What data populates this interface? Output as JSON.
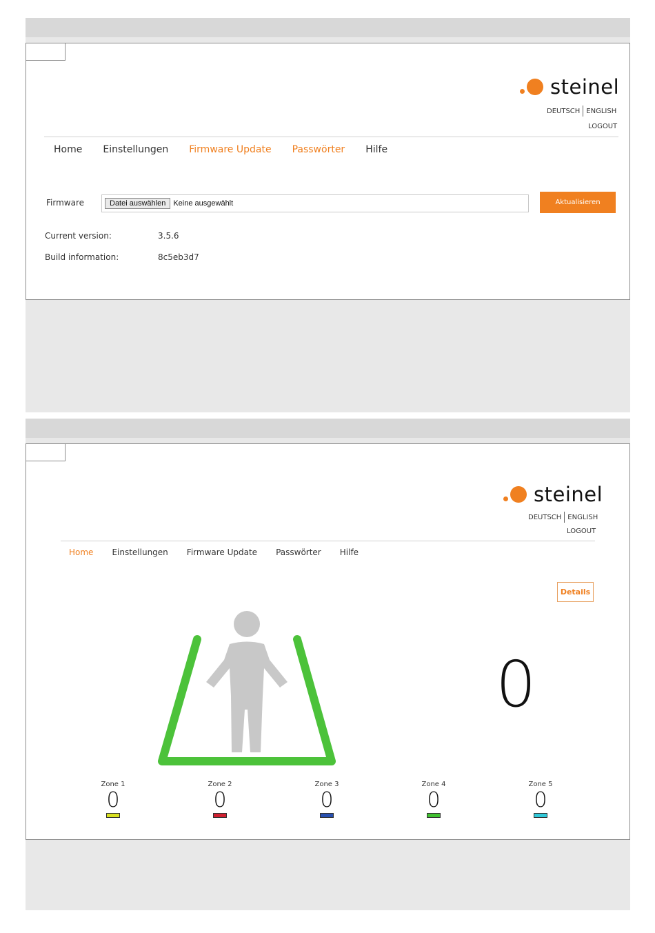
{
  "brand": {
    "logo_text": "steinel",
    "accent_color": "#f08020"
  },
  "screen1": {
    "lang_de": "DEUTSCH",
    "lang_en": "ENGLISH",
    "logout": "LOGOUT",
    "nav": [
      "Home",
      "Einstellungen",
      "Firmware Update",
      "Passwörter",
      "Hilfe"
    ],
    "active_nav": "Firmware Update",
    "firmware_label": "Firmware",
    "file_button": "Datei auswählen",
    "file_status": "Keine ausgewählt",
    "update_button": "Aktualisieren",
    "current_version_label": "Current version:",
    "current_version_value": "3.5.6",
    "build_info_label": "Build information:",
    "build_info_value": "8c5eb3d7"
  },
  "screen2": {
    "lang_de": "DEUTSCH",
    "lang_en": "ENGLISH",
    "logout": "LOGOUT",
    "nav": [
      "Home",
      "Einstellungen",
      "Firmware Update",
      "Passwörter",
      "Hilfe"
    ],
    "active_nav": "Home",
    "details_button": "Details",
    "total_count": "0",
    "zone_outline_color": "#4cc23a",
    "person_color": "#c8c8c8",
    "zones": [
      {
        "name": "Zone 1",
        "count": "0",
        "color": "#d8e020"
      },
      {
        "name": "Zone 2",
        "count": "0",
        "color": "#d02030"
      },
      {
        "name": "Zone 3",
        "count": "0",
        "color": "#2850b0"
      },
      {
        "name": "Zone 4",
        "count": "0",
        "color": "#40c030"
      },
      {
        "name": "Zone 5",
        "count": "0",
        "color": "#30c8d8"
      }
    ]
  }
}
